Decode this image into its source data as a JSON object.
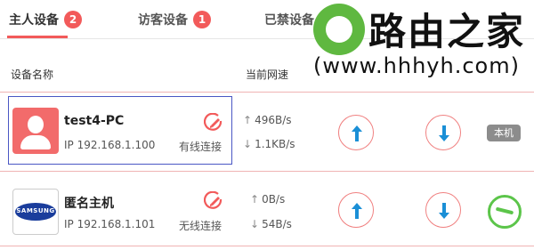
{
  "tabs": [
    {
      "label": "主人设备",
      "count": "2"
    },
    {
      "label": "访客设备",
      "count": "1"
    },
    {
      "label": "已禁设备"
    }
  ],
  "watermark": {
    "title": "路由之家",
    "url": "(www.hhhyh.com)"
  },
  "columns": {
    "name": "设备名称",
    "speed": "当前网速"
  },
  "devices": [
    {
      "name": "test4-PC",
      "ip": "IP 192.168.1.100",
      "connection": "有线连接",
      "upload": "496B/s",
      "download": "1.1KB/s",
      "tag": "本机",
      "avatar": "user-avatar-icon"
    },
    {
      "name": "匿名主机",
      "ip": "IP 192.168.1.101",
      "connection": "无线连接",
      "upload": "0B/s",
      "download": "54B/s",
      "avatar": "samsung-logo-icon",
      "logo_text": "SAMSUNG"
    }
  ],
  "colors": {
    "accent": "#f25a5a",
    "selection": "#4a57c4",
    "upload_arrow": "#1a8fd6",
    "download_arrow": "#1a8fd6",
    "block_green": "#5cc54a"
  }
}
